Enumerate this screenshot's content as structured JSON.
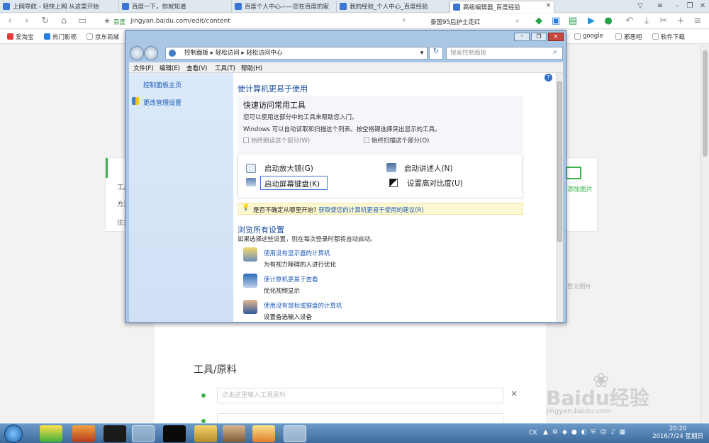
{
  "browser": {
    "tabs": [
      "上网导航 - 轻快上网 从这里开始",
      "百度一下，你就知道",
      "百度个人中心——您在百度的家",
      "我的经验_个人中心_百度经验",
      "高级编辑器_百度经验"
    ],
    "close": "×",
    "address_site": "百度",
    "url": "jingyan.baidu.com/edit/content",
    "search_text": "泰国95后护士走红",
    "bookmarks": [
      "爱淘宝",
      "热门影视",
      "京东商城"
    ],
    "bookmarks_right": [
      "google",
      "邪恶吧",
      "软件下载"
    ]
  },
  "editor": {
    "section_title": "工具/原料",
    "tool_placeholder": "点击这里输入工具原料",
    "side_items": [
      "工具",
      "方法",
      "注意"
    ],
    "add_image_label": "添加图片",
    "no_image_text": "暂无图片"
  },
  "dialog": {
    "breadcrumb": [
      "控制面板",
      "轻松访问",
      "轻松访问中心"
    ],
    "search_placeholder": "搜索控制面板",
    "menu": [
      "文件(F)",
      "编辑(E)",
      "查看(V)",
      "工具(T)",
      "帮助(H)"
    ],
    "left_links": [
      "控制面板主页",
      "更改管理设置"
    ],
    "heading": "使计算机更易于使用",
    "quick_title": "快速访问常用工具",
    "quick_desc1": "您可以使用这部分中的工具来帮助您入门。",
    "quick_desc2": "Windows 可以自动读取和扫描这个列表。按空格键选择突出显示的工具。",
    "check1": "始终朗读这个部分(W)",
    "check2": "始终扫描这个部分(O)",
    "tools": [
      "启动放大镜(G)",
      "启动讲述人(N)",
      "启动屏幕键盘(K)",
      "设置高对比度(U)"
    ],
    "tip_prefix": "是否不确定从哪里开始?",
    "tip_link": "获取使您的计算机更易于使用的建议(R)",
    "browse_title": "浏览所有设置",
    "browse_desc": "如果选择这些设置，则在每次登录时都将自动启动。",
    "settings": [
      {
        "title": "使用没有显示器的计算机",
        "desc": "为有视力障碍的人进行优化"
      },
      {
        "title": "使计算机更易于查看",
        "desc": "优化视频显示"
      },
      {
        "title": "使用没有鼠标或键盘的计算机",
        "desc": "设置备选输入设备"
      }
    ]
  },
  "taskbar": {
    "time": "20:20",
    "date": "2016/7/24 星期日",
    "ime": "CK"
  },
  "watermark": {
    "brand": "Baidu经验",
    "url": "jingyan.baidu.com"
  }
}
